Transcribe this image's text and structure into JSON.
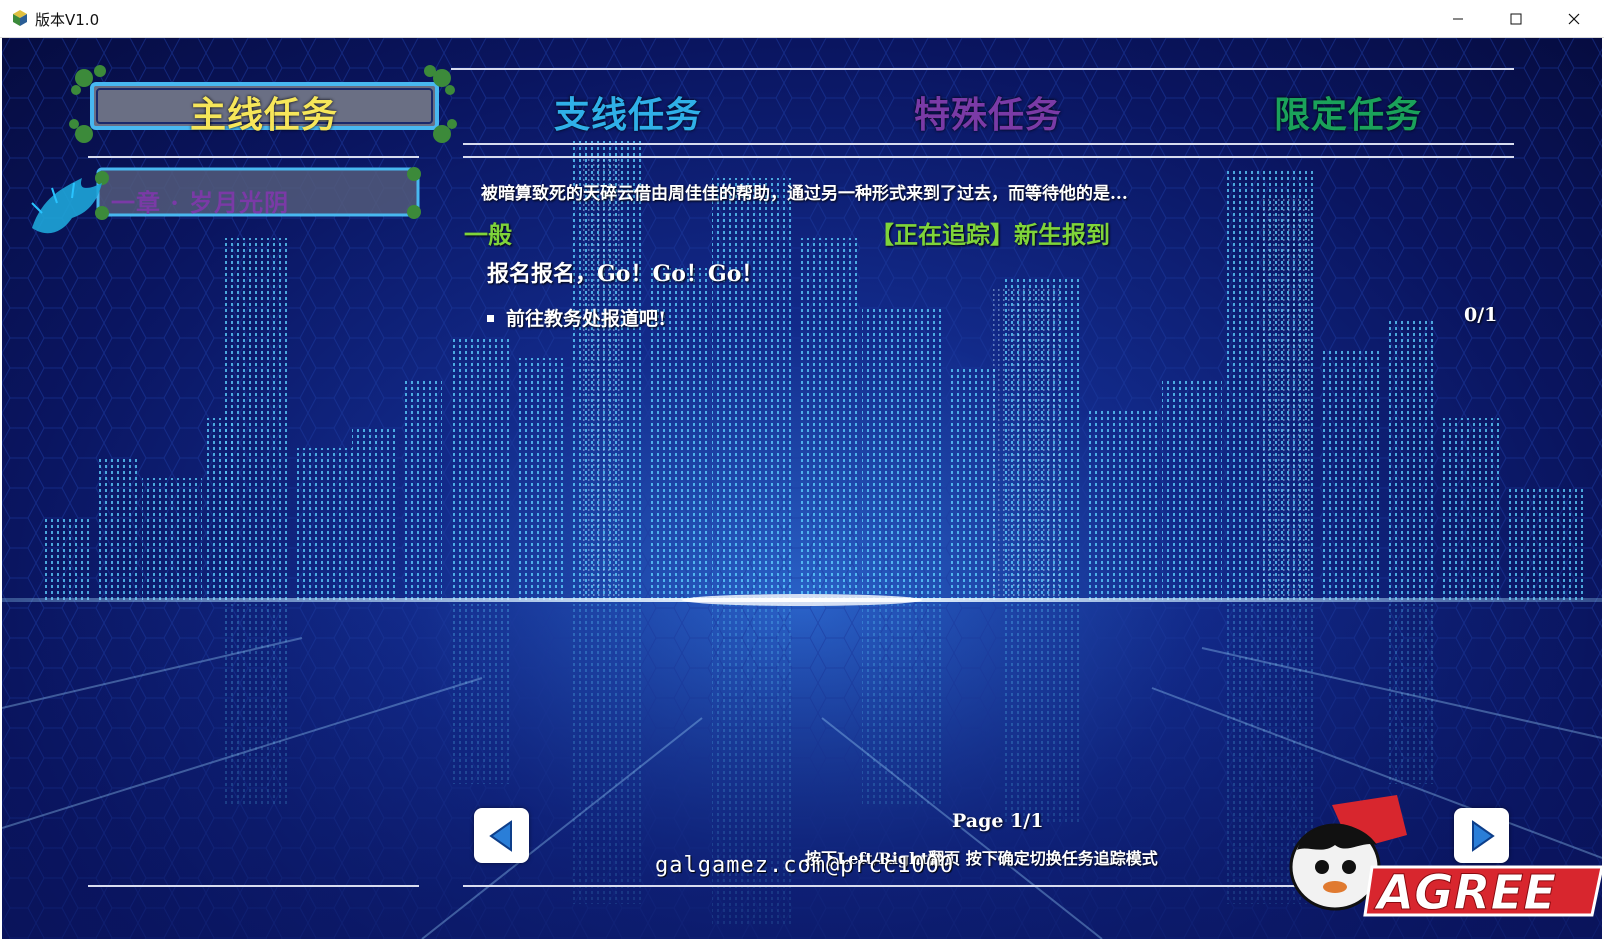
{
  "window": {
    "title": "版本V1.0",
    "icon": "game-app-icon",
    "controls": [
      "minimize-icon",
      "maximize-icon",
      "close-icon"
    ]
  },
  "tabs": [
    {
      "label": "主线任务",
      "active": true,
      "color": "#f6e65a"
    },
    {
      "label": "支线任务",
      "active": false,
      "color": "#2fb0e8"
    },
    {
      "label": "特殊任务",
      "active": false,
      "color": "#7a3aa6"
    },
    {
      "label": "限定任务",
      "active": false,
      "color": "#1aa25a"
    }
  ],
  "chapter": {
    "label": "一章 · 岁月光阴",
    "color": "#7a3aa6"
  },
  "quest": {
    "summary": "被暗算致死的天碎云借由周佳佳的帮助，通过另一种形式来到了过去，而等待他的是...",
    "category": "一般",
    "tracking": "【正在追踪】新生报到",
    "name": "报名报名，Go！Go！Go！",
    "objectives": [
      {
        "text": "前往教务处报道吧!",
        "progress": "0/1"
      }
    ]
  },
  "footer": {
    "page": "Page 1/1",
    "hint": "按下Left/Right翻页 按下确定切换任务追踪模式",
    "prev_icon": "arrow-left-icon",
    "next_icon": "arrow-right-icon"
  },
  "overlay": {
    "watermark": "galgamez.com@prcc1000",
    "logo_text": "AGREE"
  },
  "colors": {
    "accent_green": "#7fd43a",
    "background": "#0a1560",
    "frame_blue": "#3a8fd0"
  }
}
